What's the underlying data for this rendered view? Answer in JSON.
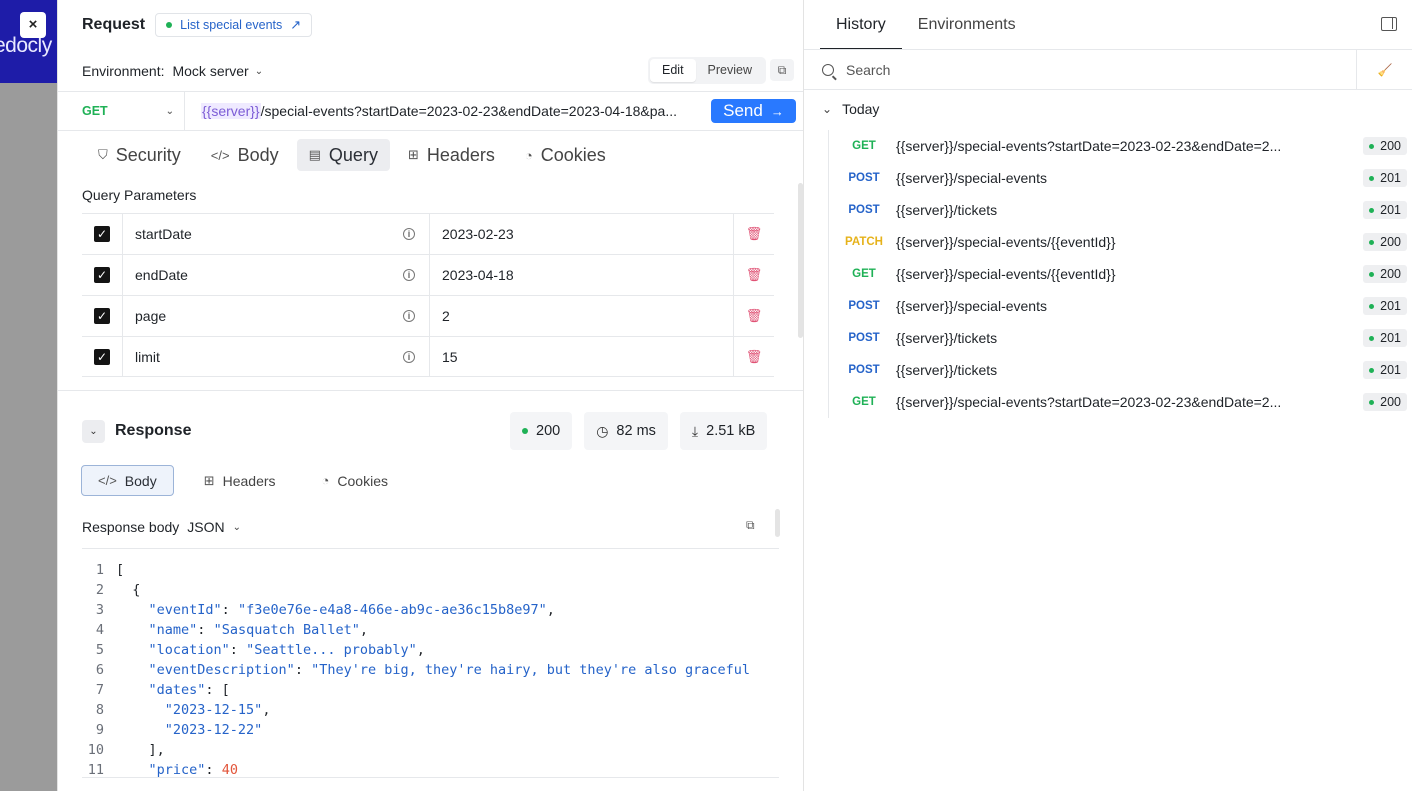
{
  "brand": {
    "text": "edocly",
    "close_label": "×"
  },
  "request": {
    "title": "Request",
    "operation": "List special events",
    "environment_label": "Environment:",
    "environment_value": "Mock server",
    "edit_label": "Edit",
    "preview_label": "Preview",
    "method": "GET",
    "url_var": "{{server}}",
    "url_rest": "/special-events?startDate=2023-02-23&endDate=2023-04-18&pa...",
    "send_label": "Send",
    "tabs": [
      {
        "label": "Security",
        "icon": "shield-icon"
      },
      {
        "label": "Body",
        "icon": "code-icon"
      },
      {
        "label": "Query",
        "icon": "query-icon",
        "active": true
      },
      {
        "label": "Headers",
        "icon": "table-icon"
      },
      {
        "label": "Cookies",
        "icon": "cookie-icon"
      }
    ],
    "query_title": "Query Parameters",
    "params": [
      {
        "name": "startDate",
        "value": "2023-02-23"
      },
      {
        "name": "endDate",
        "value": "2023-04-18"
      },
      {
        "name": "page",
        "value": "2"
      },
      {
        "name": "limit",
        "value": "15"
      }
    ]
  },
  "response": {
    "title": "Response",
    "status": "200",
    "time": "82 ms",
    "size": "2.51 kB",
    "tabs": [
      {
        "label": "Body",
        "icon": "code-icon",
        "active": true
      },
      {
        "label": "Headers",
        "icon": "table-icon"
      },
      {
        "label": "Cookies",
        "icon": "cookie-icon"
      }
    ],
    "body_label": "Response body",
    "format": "JSON",
    "lines": [
      {
        "n": "1",
        "indent": "",
        "parts": [
          [
            "txt",
            "["
          ]
        ]
      },
      {
        "n": "2",
        "indent": "  ",
        "parts": [
          [
            "txt",
            "{"
          ]
        ]
      },
      {
        "n": "3",
        "indent": "    ",
        "parts": [
          [
            "k",
            "\"eventId\""
          ],
          [
            "txt",
            ": "
          ],
          [
            "s",
            "\"f3e0e76e-e4a8-466e-ab9c-ae36c15b8e97\""
          ],
          [
            "txt",
            ","
          ]
        ]
      },
      {
        "n": "4",
        "indent": "    ",
        "parts": [
          [
            "k",
            "\"name\""
          ],
          [
            "txt",
            ": "
          ],
          [
            "s",
            "\"Sasquatch Ballet\""
          ],
          [
            "txt",
            ","
          ]
        ]
      },
      {
        "n": "5",
        "indent": "    ",
        "parts": [
          [
            "k",
            "\"location\""
          ],
          [
            "txt",
            ": "
          ],
          [
            "s",
            "\"Seattle... probably\""
          ],
          [
            "txt",
            ","
          ]
        ]
      },
      {
        "n": "6",
        "indent": "    ",
        "parts": [
          [
            "k",
            "\"eventDescription\""
          ],
          [
            "txt",
            ": "
          ],
          [
            "s",
            "\"They're big, they're hairy, but they're also graceful"
          ]
        ]
      },
      {
        "n": "7",
        "indent": "    ",
        "parts": [
          [
            "k",
            "\"dates\""
          ],
          [
            "txt",
            ": ["
          ]
        ]
      },
      {
        "n": "8",
        "indent": "      ",
        "parts": [
          [
            "s",
            "\"2023-12-15\""
          ],
          [
            "txt",
            ","
          ]
        ]
      },
      {
        "n": "9",
        "indent": "      ",
        "parts": [
          [
            "s",
            "\"2023-12-22\""
          ]
        ]
      },
      {
        "n": "10",
        "indent": "    ",
        "parts": [
          [
            "txt",
            "],"
          ]
        ]
      },
      {
        "n": "11",
        "indent": "    ",
        "parts": [
          [
            "k",
            "\"price\""
          ],
          [
            "txt",
            ": "
          ],
          [
            "n",
            "40"
          ]
        ]
      }
    ]
  },
  "history": {
    "tab_history": "History",
    "tab_environments": "Environments",
    "search_placeholder": "Search",
    "group_label": "Today",
    "items": [
      {
        "method": "GET",
        "url": "{{server}}/special-events?startDate=2023-02-23&endDate=2...",
        "status": "200"
      },
      {
        "method": "POST",
        "url": "{{server}}/special-events",
        "status": "201"
      },
      {
        "method": "POST",
        "url": "{{server}}/tickets",
        "status": "201"
      },
      {
        "method": "PATCH",
        "url": "{{server}}/special-events/{{eventId}}",
        "status": "200"
      },
      {
        "method": "GET",
        "url": "{{server}}/special-events/{{eventId}}",
        "status": "200"
      },
      {
        "method": "POST",
        "url": "{{server}}/special-events",
        "status": "201"
      },
      {
        "method": "POST",
        "url": "{{server}}/tickets",
        "status": "201"
      },
      {
        "method": "POST",
        "url": "{{server}}/tickets",
        "status": "201"
      },
      {
        "method": "GET",
        "url": "{{server}}/special-events?startDate=2023-02-23&endDate=2...",
        "status": "200"
      }
    ]
  },
  "colors": {
    "get": "#1fb156",
    "post": "#2563c9",
    "patch": "#e6b21a",
    "accent": "#2979ff",
    "brand": "#1e1ca8"
  }
}
